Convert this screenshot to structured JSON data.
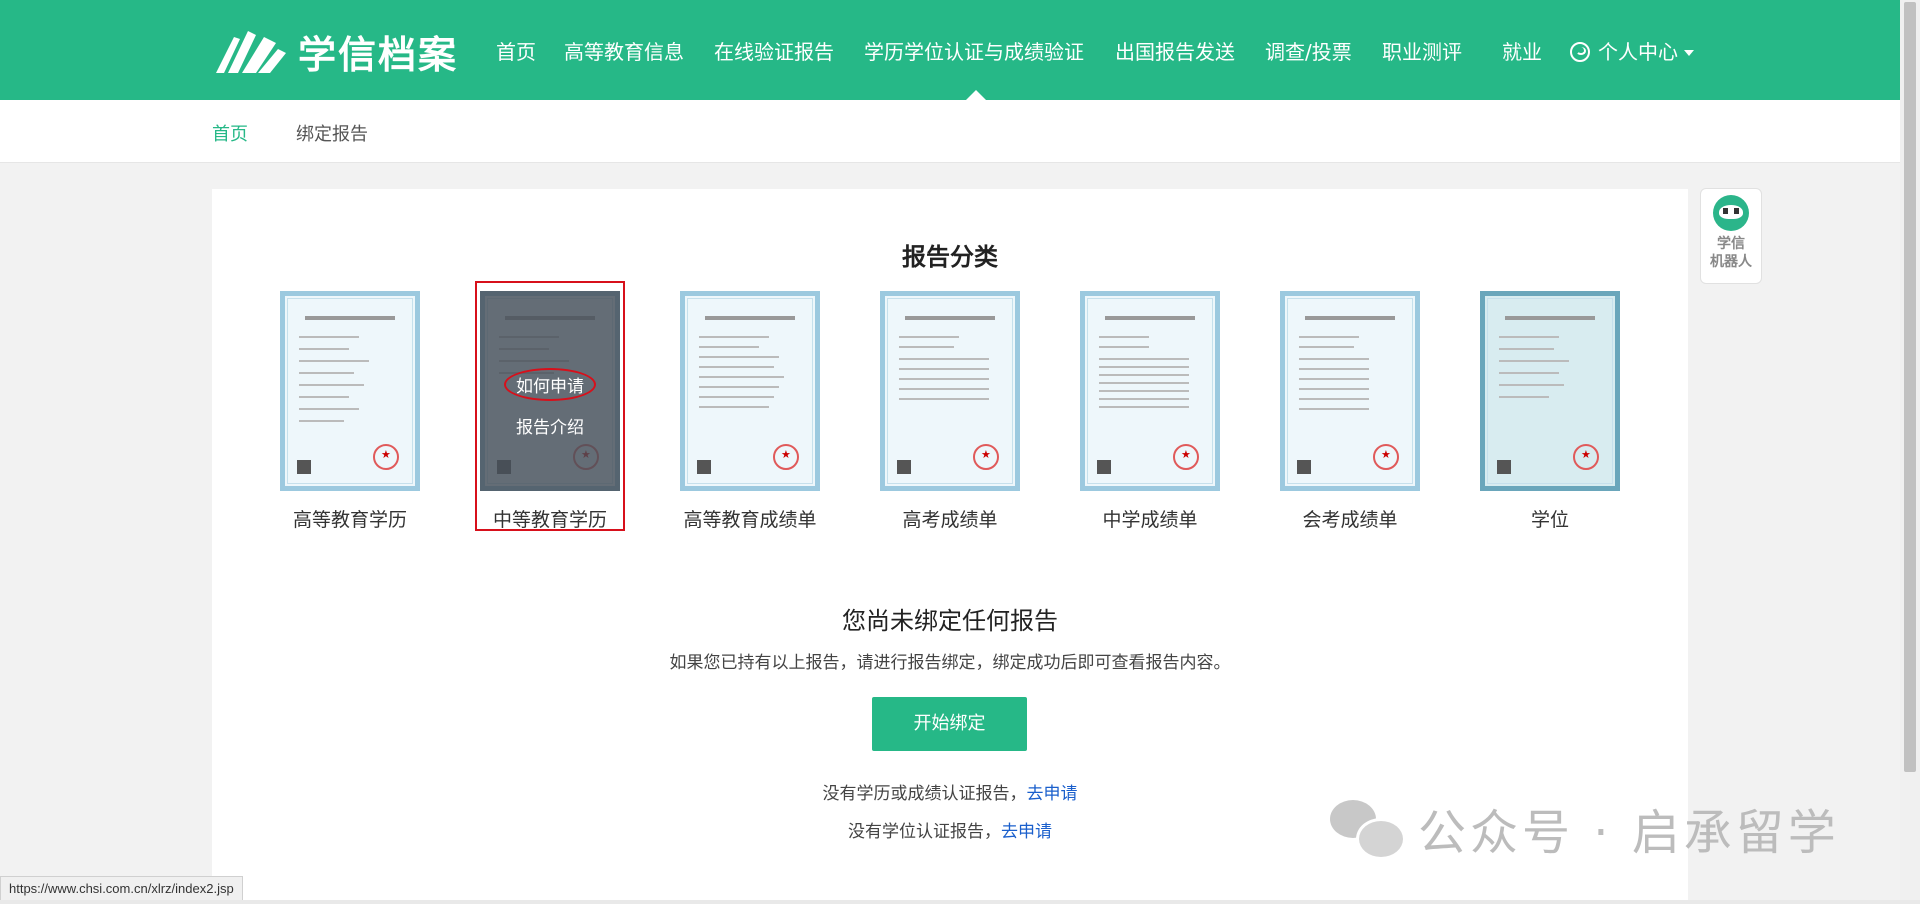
{
  "brand": {
    "name": "学信档案"
  },
  "nav": {
    "items": [
      "首页",
      "高等教育信息",
      "在线验证报告",
      "学历学位认证与成绩验证",
      "出国报告发送",
      "调查/投票",
      "职业测评",
      "就业"
    ],
    "user_menu": "个人中心",
    "active": "学历学位认证与成绩验证"
  },
  "breadcrumb": {
    "home": "首页",
    "current": "绑定报告"
  },
  "section_title": "报告分类",
  "reports": [
    {
      "label": "高等教育学历"
    },
    {
      "label": "中等教育学历"
    },
    {
      "label": "高等教育成绩单"
    },
    {
      "label": "高考成绩单"
    },
    {
      "label": "中学成绩单"
    },
    {
      "label": "会考成绩单"
    },
    {
      "label": "学位"
    }
  ],
  "overlay": {
    "apply": "如何申请",
    "intro": "报告介绍"
  },
  "empty_state": {
    "title": "您尚未绑定任何报告",
    "description": "如果您已持有以上报告，请进行报告绑定，绑定成功后即可查看报告内容。",
    "button": "开始绑定",
    "hint1_text": "没有学历或成绩认证报告，",
    "hint1_link": "去申请",
    "hint2_text": "没有学位认证报告，",
    "hint2_link": "去申请"
  },
  "robot": {
    "line1": "学信",
    "line2": "机器人"
  },
  "watermark": "公众号 · 启承留学",
  "status_url": "https://www.chsi.com.cn/xlrz/index2.jsp",
  "colors": {
    "brand_green": "#26b887",
    "link_blue": "#1a5fcc",
    "highlight_red": "#d7101b"
  }
}
